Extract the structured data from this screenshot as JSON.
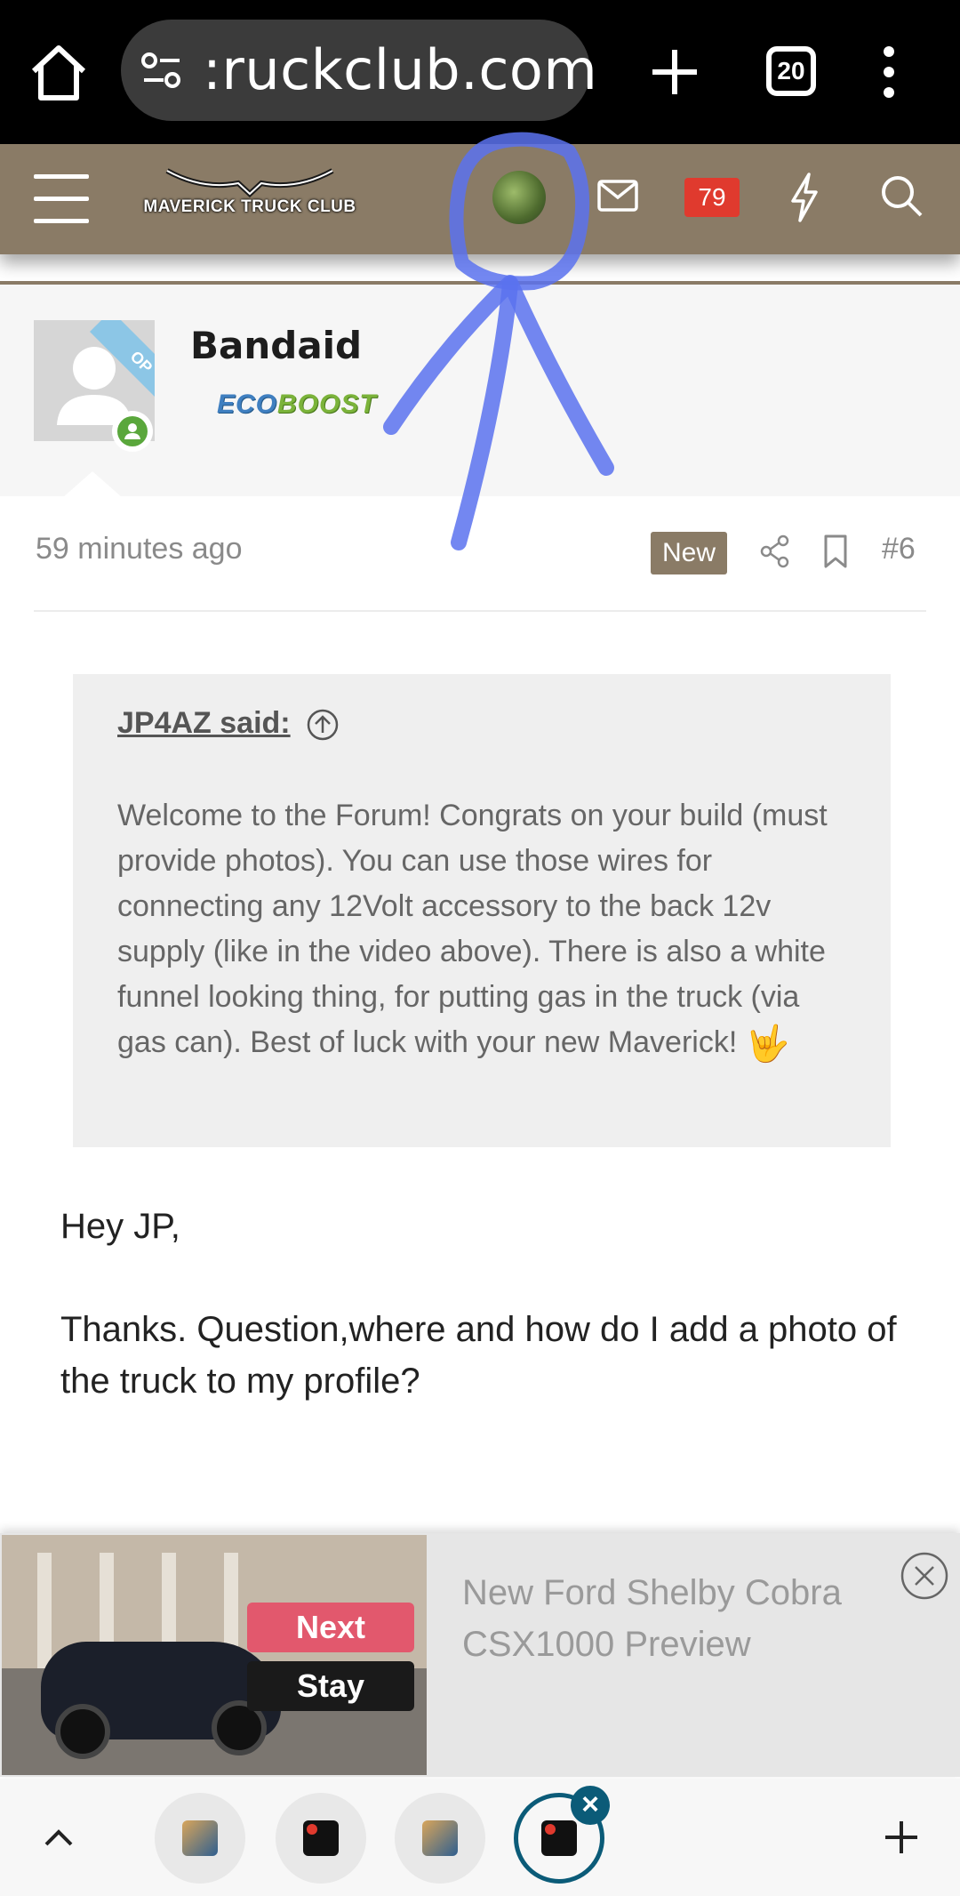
{
  "browser": {
    "url_text": ":ruckclub.com",
    "tab_count": "20"
  },
  "site": {
    "logo_text": "MAVERICK TRUCK CLUB",
    "alert_count": "79"
  },
  "post": {
    "username": "Bandaid",
    "op_label": "OP",
    "badge_eco": "ECO",
    "badge_boost": "BOOST",
    "time": "59 minutes ago",
    "new_label": "New",
    "number": "#6"
  },
  "quote": {
    "author": "JP4AZ said:",
    "text": "Welcome to the Forum! Congrats on your build (must provide photos). You can use those wires for connecting any 12Volt accessory to the back 12v supply (like in the video above). There is also a white funnel looking thing, for putting gas in the truck (via gas can). Best of luck with your new Maverick!",
    "emoji": "🤟"
  },
  "reply": {
    "greeting": "Hey JP,",
    "body": "Thanks. Question,where and how do I add a photo of the truck to my profile?"
  },
  "ad": {
    "next_label": "Next",
    "stay_label": "Stay",
    "title": "New Ford Shelby Cobra CSX1000 Preview"
  },
  "colors": {
    "header_bg": "#8a7b66",
    "badge_red": "#e03a2e",
    "annotation_blue": "#5b72ee",
    "active_tab_ring": "#0b5b78"
  }
}
